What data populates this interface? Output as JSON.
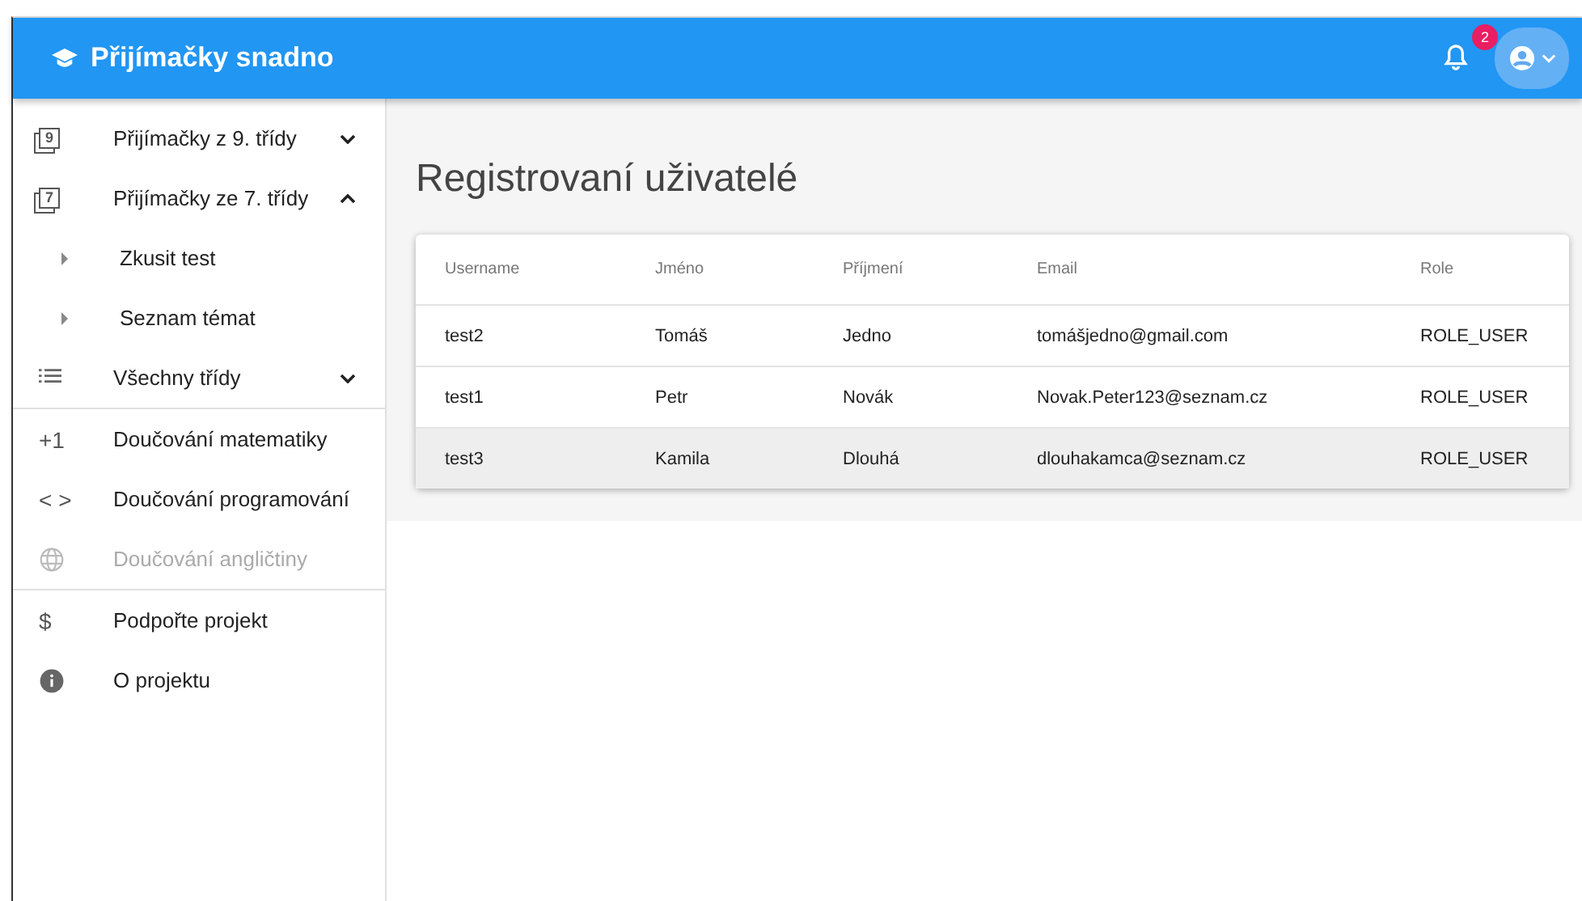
{
  "app_bar": {
    "title": "Přijímačky snadno",
    "notifications": "2"
  },
  "sidebar": {
    "sections": [
      {
        "items": [
          {
            "label": "Přijímačky z 9. třídy",
            "icon": "9",
            "kind": "group",
            "expanded": false,
            "disabled": false
          },
          {
            "label": "Přijímačky ze 7. třídy",
            "icon": "7",
            "kind": "group",
            "expanded": true,
            "disabled": false,
            "children": [
              {
                "label": "Zkusit test"
              },
              {
                "label": "Seznam témat"
              }
            ]
          },
          {
            "label": "Všechny třídy",
            "kind": "group",
            "expanded": false,
            "disabled": false
          }
        ]
      },
      {
        "items": [
          {
            "label": "Doučování matematiky",
            "icon": "+1",
            "kind": "text-icon",
            "disabled": false
          },
          {
            "label": "Doučování programování",
            "icon": "< >",
            "kind": "text-icon",
            "disabled": false
          },
          {
            "label": "Doučování angličtiny",
            "kind": "globe",
            "disabled": true
          }
        ]
      },
      {
        "items": [
          {
            "label": "Podpořte projekt",
            "icon": "$",
            "kind": "text-icon",
            "disabled": false
          },
          {
            "label": "O projektu",
            "kind": "info",
            "disabled": false
          }
        ]
      }
    ]
  },
  "page": {
    "title": "Registrovaní uživatelé"
  },
  "table": {
    "columns": [
      "Username",
      "Jméno",
      "Příjmení",
      "Email",
      "Role"
    ],
    "rows": [
      {
        "cells": [
          "test2",
          "Tomáš",
          "Jedno",
          "tomášjedno@gmail.com",
          "ROLE_USER"
        ],
        "selected": false
      },
      {
        "cells": [
          "test1",
          "Petr",
          "Novák",
          "Novak.Peter123@seznam.cz",
          "ROLE_USER"
        ],
        "selected": false
      },
      {
        "cells": [
          "test3",
          "Kamila",
          "Dlouhá",
          "dlouhakamca@seznam.cz",
          "ROLE_USER"
        ],
        "selected": true
      }
    ]
  }
}
